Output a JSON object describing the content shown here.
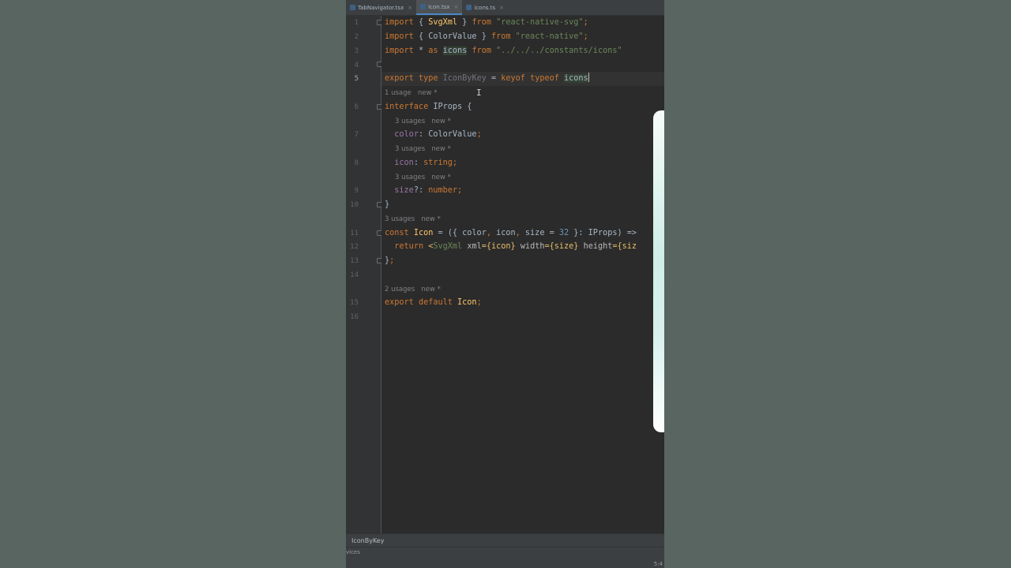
{
  "tabs": [
    {
      "label": "TabNavigator.tsx",
      "active": false
    },
    {
      "label": "Icon.tsx",
      "active": true
    },
    {
      "label": "icons.ts",
      "active": false
    }
  ],
  "close_glyph": "×",
  "lines": [
    {
      "n": "1"
    },
    {
      "n": "2"
    },
    {
      "n": "3"
    },
    {
      "n": "4"
    },
    {
      "n": "5"
    },
    {
      "n": "6"
    },
    {
      "n": "7"
    },
    {
      "n": "8"
    },
    {
      "n": "9"
    },
    {
      "n": "10"
    },
    {
      "n": "11"
    },
    {
      "n": "12"
    },
    {
      "n": "13"
    },
    {
      "n": "14"
    },
    {
      "n": "15"
    },
    {
      "n": "16"
    }
  ],
  "code": {
    "l1": {
      "kw1": "import",
      "p1": " { ",
      "name": "SvgXml",
      "p2": " } ",
      "kw2": "from",
      "sp": " ",
      "str": "\"react-native-svg\"",
      "end": ";"
    },
    "l2": {
      "kw1": "import",
      "p1": " { ",
      "name": "ColorValue",
      "p2": " } ",
      "kw2": "from",
      "sp": " ",
      "str": "\"react-native\"",
      "end": ";"
    },
    "l3": {
      "kw1": "import",
      "p1": " * ",
      "kw2": "as",
      "sp1": " ",
      "name": "icons",
      "sp2": " ",
      "kw3": "from",
      "sp3": " ",
      "str": "\"../../../constants/icons\""
    },
    "l5": {
      "kw1": "export",
      "sp1": " ",
      "kw2": "type",
      "sp2": " ",
      "name": "IconByKey",
      "p1": " = ",
      "kw3": "keyof",
      "sp3": " ",
      "kw4": "typeof",
      "sp4": " ",
      "ref": "icons"
    },
    "l6": {
      "kw": "interface",
      "rest": " IProps {"
    },
    "l7": {
      "indent": "  ",
      "prop": "color",
      "rest": ": ColorValue",
      "end": ";"
    },
    "l8": {
      "indent": "  ",
      "prop": "icon",
      "p": ": ",
      "kw": "string",
      "end": ";"
    },
    "l9": {
      "indent": "  ",
      "prop": "size",
      "p": "?: ",
      "kw": "number",
      "end": ";"
    },
    "l10": {
      "text": "}"
    },
    "l11": {
      "kw": "const",
      "sp": " ",
      "fn": "Icon",
      "p1": " = ({ color",
      "c1": ",",
      "p2": " icon",
      "c2": ",",
      "p3": " size = ",
      "num": "32",
      "p4": " }: IProps) =>"
    },
    "l12": {
      "indent": "  ",
      "kw": "return",
      "sp": " ",
      "lt": "<",
      "tag": "SvgXml",
      "sp2": " ",
      "a1": "xml",
      "v1": "={icon}",
      "sp3": " ",
      "a2": "width",
      "v2": "={size}",
      "sp4": " ",
      "a3": "height",
      "v3": "={siz"
    },
    "l13": {
      "text": "}",
      "end": ";"
    },
    "l15": {
      "kw1": "export",
      "sp": " ",
      "kw2": "default",
      "sp2": " ",
      "fn": "Icon",
      "end": ";"
    }
  },
  "hints": {
    "h5": "1 usage   new *",
    "h6a": "3 usages   new *",
    "h7": "3 usages   new *",
    "h8": "3 usages   new *",
    "h10": "3 usages   new *",
    "h14": "2 usages   new *"
  },
  "bottom_tool": "IconByKey",
  "status": {
    "left": "vices",
    "right": "5:4"
  }
}
